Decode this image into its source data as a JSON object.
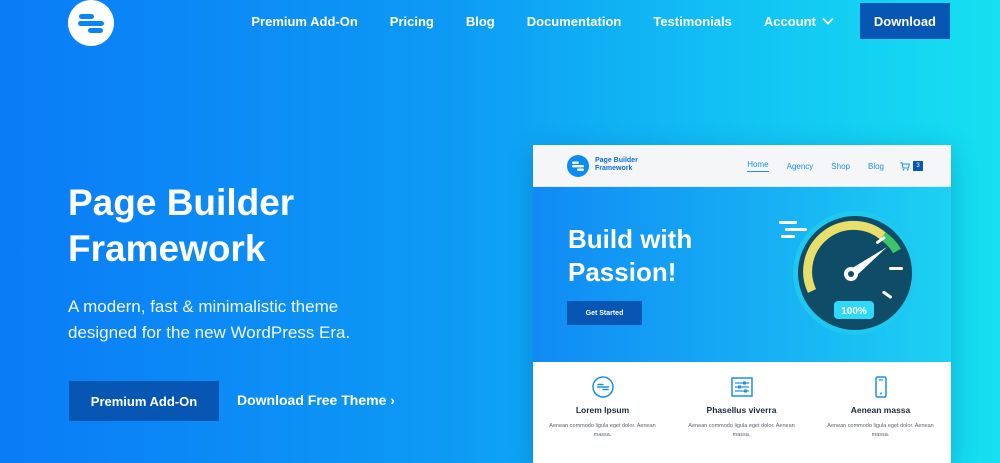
{
  "header": {
    "nav": [
      "Premium Add-On",
      "Pricing",
      "Blog",
      "Documentation",
      "Testimonials",
      "Account"
    ],
    "download_label": "Download"
  },
  "hero": {
    "title": "Page Builder Framework",
    "subtitle": "A modern, fast & minimalistic theme designed for the new WordPress Era.",
    "primary_button": "Premium Add-On",
    "secondary_link": "Download Free Theme ›"
  },
  "mockup": {
    "brand": "Page Builder Framework",
    "nav": [
      "Home",
      "Agency",
      "Shop",
      "Blog"
    ],
    "cart_count": "3",
    "hero_title": "Build with Passion!",
    "cta": "Get Started",
    "gauge_label": "100%",
    "features": [
      {
        "icon": "equals-circle-icon",
        "title": "Lorem Ipsum",
        "text": "Aenean commodo ligula eget dolor. Aenean massa."
      },
      {
        "icon": "sliders-icon",
        "title": "Phasellus viverra",
        "text": "Aenean commodo ligula eget dolor. Aenean massa."
      },
      {
        "icon": "mobile-icon",
        "title": "Aenean massa",
        "text": "Aenean commodo ligula eget dolor. Aenean massa."
      }
    ]
  },
  "colors": {
    "brand_dark": "#0756b4",
    "gradient_start": "#0a7cf6",
    "gradient_end": "#16e0f0",
    "gauge_dark": "#0f4c68",
    "gauge_badge": "#2fd8f8"
  }
}
